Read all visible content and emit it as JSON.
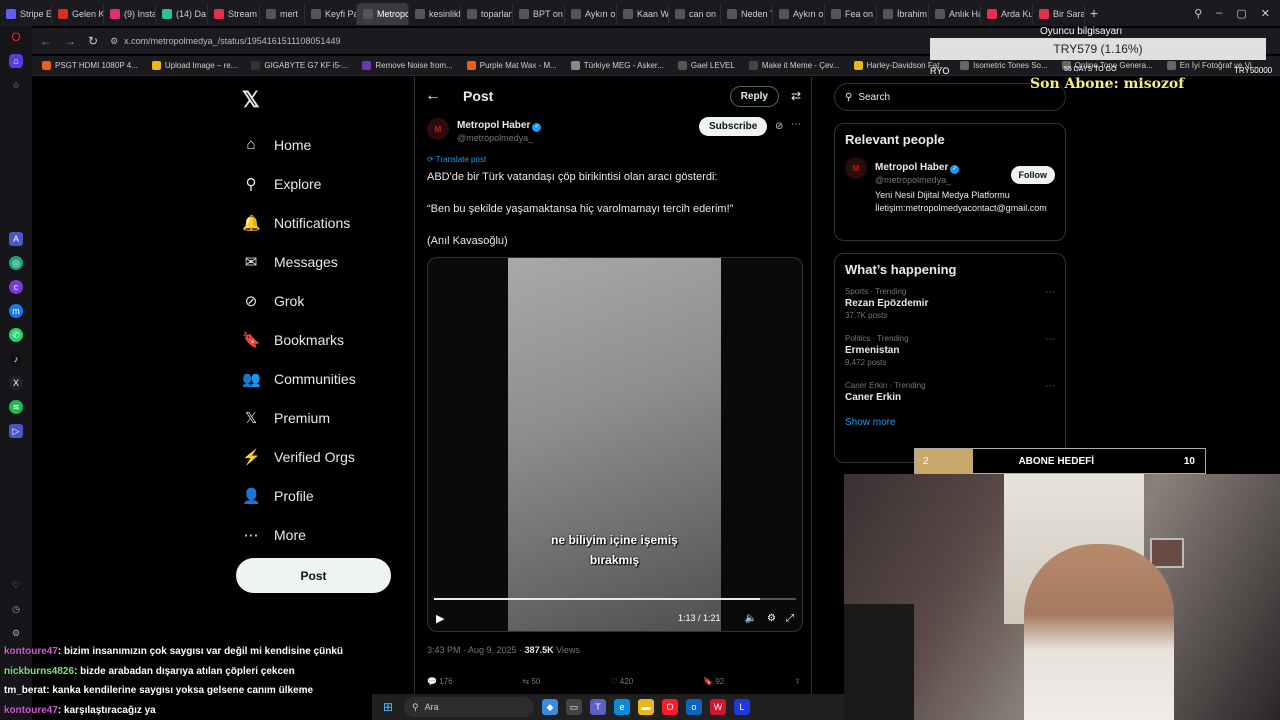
{
  "browser": {
    "tabs": [
      {
        "label": "Stripe E",
        "color": "#635bff"
      },
      {
        "label": "Gelen K",
        "color": "#d93025"
      },
      {
        "label": "(9) Insta",
        "color": "#e1306c"
      },
      {
        "label": "(14) Da",
        "color": "#29c29a"
      },
      {
        "label": "Stream",
        "color": "#e62e4d"
      },
      {
        "label": "mert",
        "color": "#555555"
      },
      {
        "label": "Keyfi Pa",
        "color": "#555555"
      },
      {
        "label": "Metropol Habe",
        "color": "#555555",
        "active": true
      },
      {
        "label": "kesinlikle",
        "color": "#555555"
      },
      {
        "label": "toparlan",
        "color": "#555555"
      },
      {
        "label": "BPT on",
        "color": "#555555"
      },
      {
        "label": "Aykırı on",
        "color": "#555555"
      },
      {
        "label": "Kaan W",
        "color": "#555555"
      },
      {
        "label": "can on",
        "color": "#555555"
      },
      {
        "label": "Neden T",
        "color": "#555555"
      },
      {
        "label": "Aykırı on",
        "color": "#555555"
      },
      {
        "label": "Fea on",
        "color": "#555555"
      },
      {
        "label": "İbrahim",
        "color": "#555555"
      },
      {
        "label": "Anlık Ha",
        "color": "#555555"
      },
      {
        "label": "Arda Ku",
        "color": "#e62e4d"
      },
      {
        "label": "Bir Sarac",
        "color": "#e62e4d"
      }
    ],
    "new_tab": "+",
    "url": "x.com/metropolmedya_/status/1954161511108051449",
    "bookmarks": [
      {
        "label": "PSGT HDMI 1080P 4...",
        "color": "#e8621a"
      },
      {
        "label": "Upload Image – re...",
        "color": "#e8b81a"
      },
      {
        "label": "GIGABYTE G7 KF i5-...",
        "color": "#333333"
      },
      {
        "label": "Remove Noise from...",
        "color": "#6a3aa8"
      },
      {
        "label": "Purple Mat Wax - M...",
        "color": "#e8621a"
      },
      {
        "label": "Türkiye MEG - Asker...",
        "color": "#888888"
      },
      {
        "label": "Gael LEVEL",
        "color": "#555555"
      },
      {
        "label": "Make it Meme - Çev...",
        "color": "#444444"
      },
      {
        "label": "Harley-Davidson Fat...",
        "color": "#e8b81a"
      },
      {
        "label": "Isometric Tones So...",
        "color": "#666666"
      },
      {
        "label": "Online Tone Genera...",
        "color": "#666666"
      },
      {
        "label": "En İyi Fotoğraf ve Vi...",
        "color": "#666666"
      }
    ]
  },
  "x": {
    "nav": [
      {
        "label": "Home",
        "icon": "⌂",
        "name": "home"
      },
      {
        "label": "Explore",
        "icon": "⚲",
        "name": "explore"
      },
      {
        "label": "Notifications",
        "icon": "🔔",
        "name": "notifications"
      },
      {
        "label": "Messages",
        "icon": "✉",
        "name": "messages"
      },
      {
        "label": "Grok",
        "icon": "⊘",
        "name": "grok"
      },
      {
        "label": "Bookmarks",
        "icon": "🔖",
        "name": "bookmarks"
      },
      {
        "label": "Communities",
        "icon": "👥",
        "name": "communities"
      },
      {
        "label": "Premium",
        "icon": "𝕏",
        "name": "premium"
      },
      {
        "label": "Verified Orgs",
        "icon": "⚡",
        "name": "verified-orgs"
      },
      {
        "label": "Profile",
        "icon": "👤",
        "name": "profile"
      },
      {
        "label": "More",
        "icon": "⋯",
        "name": "more"
      }
    ],
    "post_button": "Post",
    "header_title": "Post",
    "reply_label": "Reply",
    "author_name": "Metropol Haber",
    "author_handle": "@metropolmedya_",
    "avatar_text": "M",
    "subscribe_label": "Subscribe",
    "translate_label": "Translate post",
    "tweet_lines": [
      "ABD'de bir Türk vatandaşı çöp birikintisi olan aracı gösterdi:",
      "“Ben bu şekilde yaşamaktansa hiç varolmamayı tercih ederim!”",
      "(Anıl Kavasoğlu)"
    ],
    "video": {
      "subtitle_line1": "ne biliyim içine işemiş",
      "subtitle_line2": "bırakmış",
      "time": "1:13 / 1:21",
      "progress": 0.9
    },
    "meta_time": "3:43 PM · Aug 9, 2025 · ",
    "meta_views": "387.5K",
    "meta_views_label": " Views",
    "actions": [
      "176",
      "50",
      "420",
      "92"
    ],
    "search_placeholder": "Search",
    "relevant_title": "Relevant people",
    "relevant_person": {
      "name": "Metropol Haber",
      "handle": "@metropolmedya_",
      "bio": "Yeni Nesil Dijital Medya Platformu İletişim:metropolmedyacontact@gmail.com",
      "follow_label": "Follow"
    },
    "happening_title": "What’s happening",
    "trends": [
      {
        "category": "Sports · Trending",
        "name": "Rezan Epözdemir",
        "count": "37.7K posts"
      },
      {
        "category": "Politics · Trending",
        "name": "Ermenistan",
        "count": "9,472 posts"
      },
      {
        "category": "Caner Erkin · Trending",
        "name": "Caner Erkin",
        "count": ""
      }
    ],
    "show_more": "Show more"
  },
  "overlay": {
    "label": "Oyuncu bilgisayarı",
    "price": "TRY579 (1.16%)",
    "left": "RYO",
    "days": "55 DAYS TO GO",
    "right": "TRY50000",
    "last_sub": "Son Abone: misozof",
    "goal_current": "2",
    "goal_label": "ABONE HEDEFİ",
    "goal_target": "10",
    "goal_progress": 0.2
  },
  "chat": [
    {
      "user": "kontoure47",
      "msg": ": bizim insanımızın çok saygısı var değil mi kendisine çünkü",
      "style": "pink"
    },
    {
      "user": "nickburns4826",
      "msg": ": bizde arabadan dışarıya atılan çöpleri çekcen",
      "style": "green"
    },
    {
      "user": "tm_berat",
      "msg": ": kanka kendilerine saygısı yoksa gelsene canım ülkeme",
      "style": "white"
    },
    {
      "user": "kontoure47",
      "msg": ": karşılaştıracağız ya",
      "style": "pink"
    }
  ],
  "taskbar": {
    "search_label": "Ara"
  }
}
